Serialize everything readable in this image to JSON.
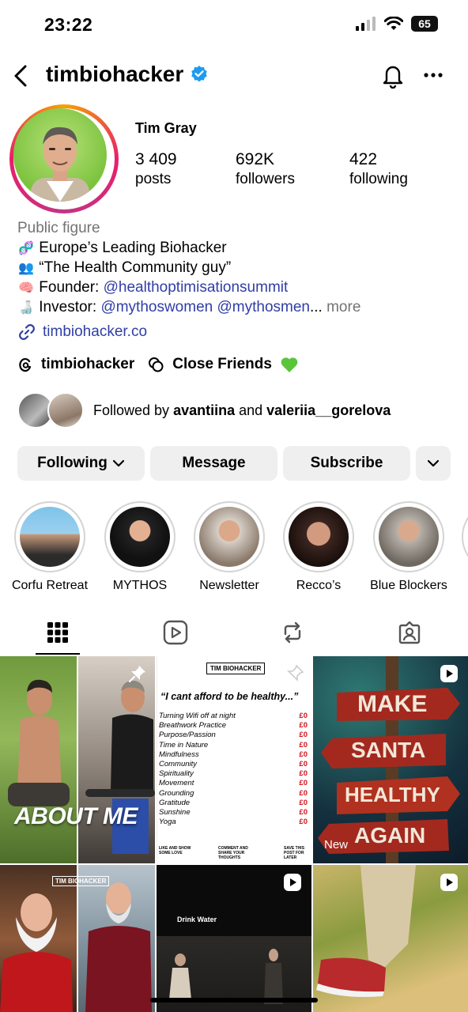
{
  "status": {
    "time": "23:22",
    "battery": "65"
  },
  "header": {
    "username": "timbiohacker"
  },
  "profile": {
    "name": "Tim Gray",
    "stats": [
      {
        "value": "3 409",
        "label": "posts"
      },
      {
        "value": "692K",
        "label": "followers"
      },
      {
        "value": "422",
        "label": "following"
      }
    ],
    "category": "Public figure",
    "bio": {
      "line1": "Europe’s Leading Biohacker",
      "line2": "“The Health Community guy”",
      "line3_prefix": "Founder: ",
      "line3_link": "@healthoptimisationsummit",
      "line4_prefix": "Investor: ",
      "line4_link": "@mythoswomen @mythosmen",
      "line4_more_dots": "...",
      "line4_more": " more"
    },
    "website": "timbiohacker.co",
    "threads_handle": "timbiohacker",
    "close_friends": "Close Friends",
    "followed_by": {
      "prefix": "Followed by ",
      "user1": "avantiina",
      "mid": " and ",
      "user2": "valeriia__gorelova"
    }
  },
  "buttons": {
    "following": "Following",
    "message": "Message",
    "subscribe": "Subscribe"
  },
  "highlights": [
    {
      "label": "Corfu Retreat"
    },
    {
      "label": "MYTHOS"
    },
    {
      "label": "Newsletter"
    },
    {
      "label": "Recco’s"
    },
    {
      "label": "Blue Blockers"
    }
  ],
  "tabs": [
    "grid-icon",
    "reels-icon",
    "reposts-icon",
    "tagged-icon"
  ],
  "posts": {
    "p1": {
      "overlay": "ABOUT ME"
    },
    "p2": {
      "brand": "TIM BIOHACKER",
      "title": "“I cant afford to be healthy...”",
      "items": [
        "Turning Wifi off at night",
        "Breathwork Practice",
        "Purpose/Passion",
        "Time in Nature",
        "Mindfulness",
        "Community",
        "Spirituality",
        "Movement",
        "Grounding",
        "Gratitude",
        "Sunshine",
        "Yoga"
      ],
      "price": "£0",
      "footer1": "LIKE AND SHOW SOME LOVE",
      "footer2": "COMMENT AND SHARE YOUR THOUGHTS",
      "footer3": "SAVE THIS POST FOR LATER"
    },
    "p3": {
      "signs": [
        "MAKE",
        "SANTA",
        "HEALTHY",
        "AGAIN"
      ],
      "badge": "New"
    },
    "p4": {
      "brand": "TIM BIOHACKER"
    },
    "p5": {
      "caption": "Drink Water"
    }
  }
}
